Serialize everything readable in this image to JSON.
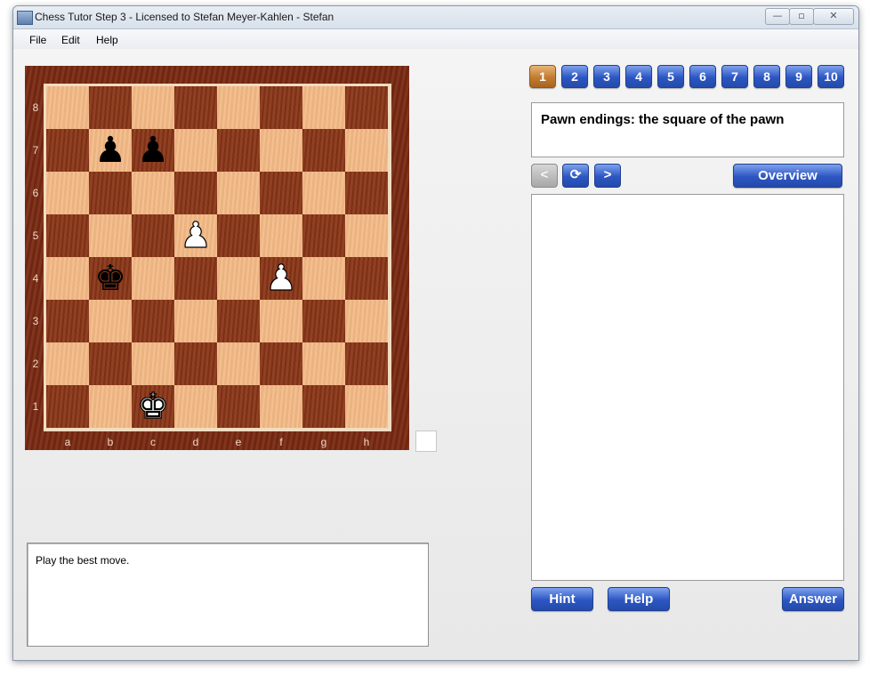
{
  "window": {
    "title": "Chess Tutor Step 3 - Licensed to Stefan Meyer-Kahlen - Stefan"
  },
  "window_controls": {
    "minimize": "—",
    "maximize": "▫",
    "close": "✕"
  },
  "menu": [
    "File",
    "Edit",
    "Help"
  ],
  "board": {
    "ranks": [
      "8",
      "7",
      "6",
      "5",
      "4",
      "3",
      "2",
      "1"
    ],
    "files": [
      "a",
      "b",
      "c",
      "d",
      "e",
      "f",
      "g",
      "h"
    ],
    "pieces": [
      {
        "square": "b7",
        "piece": "black-pawn",
        "glyph": "♟"
      },
      {
        "square": "c7",
        "piece": "black-pawn",
        "glyph": "♟"
      },
      {
        "square": "d5",
        "piece": "white-pawn",
        "glyph": "♟"
      },
      {
        "square": "b4",
        "piece": "black-king",
        "glyph": "♚"
      },
      {
        "square": "f4",
        "piece": "white-pawn",
        "glyph": "♟"
      },
      {
        "square": "c1",
        "piece": "white-king",
        "glyph": "♚"
      }
    ]
  },
  "lesson_numbers": [
    "1",
    "2",
    "3",
    "4",
    "5",
    "6",
    "7",
    "8",
    "9",
    "10"
  ],
  "active_lesson": "1",
  "lesson_title": "Pawn endings: the square of the pawn",
  "nav": {
    "back": "<",
    "refresh": "⟳",
    "forward": ">"
  },
  "overview_label": "Overview",
  "comment": "Play the best move.",
  "buttons": {
    "hint": "Hint",
    "help": "Help",
    "answer": "Answer"
  },
  "colors": {
    "light_square": "#f3b985",
    "dark_square": "#8a3617",
    "accent_blue": "#2c56c2",
    "active_orange": "#c27b31"
  }
}
